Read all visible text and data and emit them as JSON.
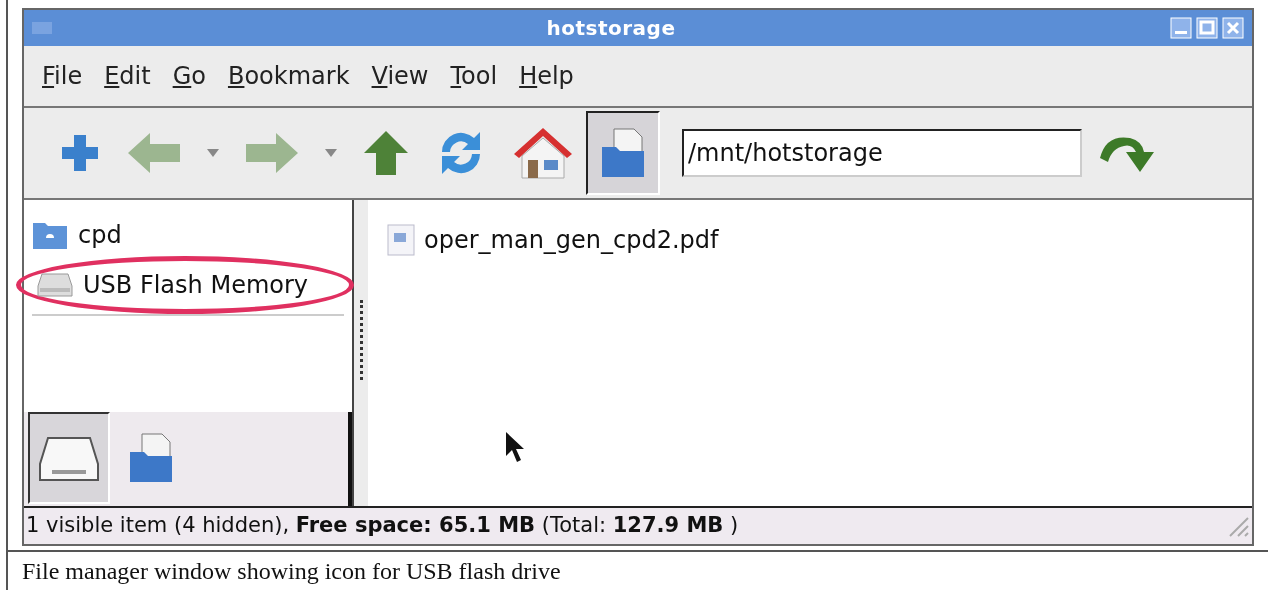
{
  "window": {
    "title": "hotstorage"
  },
  "menu": [
    "File",
    "Edit",
    "Go",
    "Bookmark",
    "View",
    "Tool",
    "Help"
  ],
  "toolbar": [
    {
      "kind": "new",
      "selected": false
    },
    {
      "kind": "back",
      "selected": false
    },
    {
      "kind": "dropdown",
      "selected": false
    },
    {
      "kind": "forward",
      "selected": false
    },
    {
      "kind": "dropdown",
      "selected": false
    },
    {
      "kind": "up",
      "selected": false
    },
    {
      "kind": "reload",
      "selected": false
    },
    {
      "kind": "home",
      "selected": false
    },
    {
      "kind": "folder",
      "selected": true
    }
  ],
  "location": {
    "value": "/mnt/hotstorage"
  },
  "places": [
    {
      "label": "cpd",
      "kind": "folder",
      "circled": false
    },
    {
      "label": "USB Flash Memory",
      "kind": "drive",
      "circled": true
    }
  ],
  "side_tabs": [
    {
      "kind": "drive",
      "selected": true
    },
    {
      "kind": "folder",
      "selected": false
    }
  ],
  "files": [
    {
      "name": "oper_man_gen_cpd2.pdf"
    }
  ],
  "status_bar": "1 visible item (4 hidden), **Free space: 65.1 MB** (Total: **127.9 MB** )",
  "caption": "File manager window showing icon for USB flash drive"
}
